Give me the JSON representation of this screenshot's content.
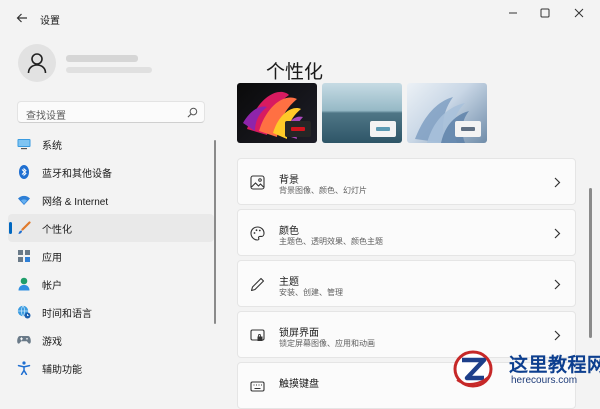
{
  "window": {
    "title": "设置"
  },
  "search": {
    "placeholder": "查找设置",
    "icon": "search-icon"
  },
  "sidebar": {
    "items": [
      {
        "label": "系统",
        "icon": "monitor-icon",
        "active": false
      },
      {
        "label": "蓝牙和其他设备",
        "icon": "bluetooth-icon",
        "active": false
      },
      {
        "label": "网络 & Internet",
        "icon": "wifi-icon",
        "active": false
      },
      {
        "label": "个性化",
        "icon": "brush-icon",
        "active": true
      },
      {
        "label": "应用",
        "icon": "apps-icon",
        "active": false
      },
      {
        "label": "帐户",
        "icon": "person-icon",
        "active": false
      },
      {
        "label": "时间和语言",
        "icon": "globe-clock-icon",
        "active": false
      },
      {
        "label": "游戏",
        "icon": "gamepad-icon",
        "active": false
      },
      {
        "label": "辅助功能",
        "icon": "accessibility-icon",
        "active": false
      }
    ]
  },
  "main": {
    "title": "个性化",
    "themes": [
      {
        "name": "glow",
        "accent": "#d1141d"
      },
      {
        "name": "captured-motion-lake",
        "accent": "#5b9ab3"
      },
      {
        "name": "bloom-light",
        "accent": "#5f6f82"
      }
    ],
    "cards": [
      {
        "title": "背景",
        "desc": "背景图像、颜色、幻灯片",
        "icon": "picture-icon"
      },
      {
        "title": "颜色",
        "desc": "主题色、透明效果、颜色主题",
        "icon": "palette-icon"
      },
      {
        "title": "主题",
        "desc": "安装、创建、管理",
        "icon": "pen-icon"
      },
      {
        "title": "锁屏界面",
        "desc": "锁定屏幕图像、应用和动画",
        "icon": "lock-screen-icon"
      },
      {
        "title": "触摸键盘",
        "desc": "",
        "icon": "keyboard-icon"
      }
    ]
  },
  "watermark": {
    "text_cn": "这里教程网",
    "text_en": "herecours.com"
  },
  "colors": {
    "accent": "#0067c0",
    "background": "#f3f3f3",
    "card": "#fbfbfb"
  }
}
